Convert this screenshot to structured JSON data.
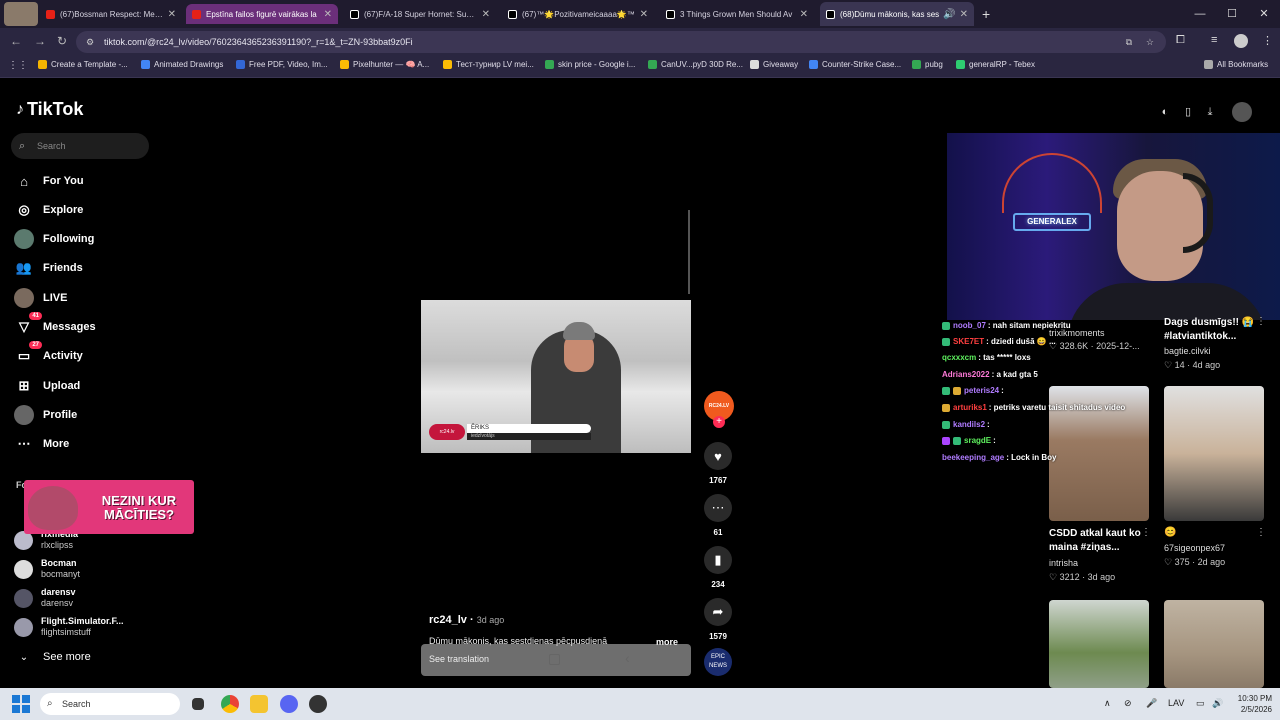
{
  "browser": {
    "tabs": [
      {
        "label": "(67)Bossman Respect: Memorable",
        "favicon_color": "#e62117"
      },
      {
        "label": "Epstīna failos figurē vairākas la",
        "favicon_color": "#e62117"
      },
      {
        "label": "(67)F/A-18 Super Hornet: Super",
        "favicon_color": "#000000"
      },
      {
        "label": "(67)™🌟Pozitivameicaaaa🌟™",
        "favicon_color": "#000000"
      },
      {
        "label": "3 Things Grown Men Should Av",
        "favicon_color": "#000000"
      },
      {
        "label": "(68)Dūmu mākonis, kas ses",
        "favicon_color": "#000000"
      }
    ],
    "new_tab": "+",
    "window_controls": {
      "minimize": "—",
      "maximize": "☐",
      "close": "✕"
    },
    "url": "tiktok.com/@rc24_lv/video/7602364365236391190?_r=1&_t=ZN-93bbat9z0Fi",
    "bookmarks": [
      {
        "label": "Create a Template -...",
        "color": "#f4b400"
      },
      {
        "label": "Animated Drawings",
        "color": "#4285f4"
      },
      {
        "label": "Free PDF, Video, Im...",
        "color": "#3367d6"
      },
      {
        "label": "Pixelhunter — 🧠 A...",
        "color": "#fbbc05"
      },
      {
        "label": "Тест-турнир LV mei...",
        "color": "#fbbc05"
      },
      {
        "label": "skin price - Google i...",
        "color": "#34a853"
      },
      {
        "label": "CanUV...pyD 30D Re...",
        "color": "#34a853"
      },
      {
        "label": "Giveaway",
        "color": "#dddddd"
      },
      {
        "label": "Counter-Strike Case...",
        "color": "#4285f4"
      },
      {
        "label": "pubg",
        "color": "#34a853"
      },
      {
        "label": "generalRP - Tebex",
        "color": "#2ecc71"
      }
    ],
    "all_bookmarks": "All Bookmarks"
  },
  "tiktok": {
    "logo": "TikTok",
    "search_placeholder": "Search",
    "nav": [
      {
        "label": "For You",
        "icon": "home-icon"
      },
      {
        "label": "Explore",
        "icon": "compass-icon"
      },
      {
        "label": "Following",
        "icon": "following-avatar"
      },
      {
        "label": "Friends",
        "icon": "friends-icon"
      },
      {
        "label": "LIVE",
        "icon": "live-avatar"
      },
      {
        "label": "Messages",
        "icon": "messages-icon",
        "badge": "41"
      },
      {
        "label": "Activity",
        "icon": "activity-icon",
        "badge": "27"
      },
      {
        "label": "Upload",
        "icon": "upload-icon"
      },
      {
        "label": "Profile",
        "icon": "profile-avatar"
      },
      {
        "label": "More",
        "icon": "more-icon"
      }
    ],
    "following_header": "Fo",
    "following_accounts": [
      {
        "name": "rlxmedia",
        "handle": "rlxclipss"
      },
      {
        "name": "Bocman",
        "handle": "bocmanyt"
      },
      {
        "name": "darensv",
        "handle": "darensv"
      },
      {
        "name": "Flight.Simulator.F...",
        "handle": "flightsimstuff"
      }
    ],
    "see_more": "See more",
    "ad_text": "NEZINI KUR MĀCĪTIES?",
    "video": {
      "lower_third_name": "ĒRIKS",
      "lower_third_sub": "iedzīvotājs",
      "channel_logo": "rc24.lv",
      "author": "rc24_lv",
      "date": "3d ago",
      "caption": "Dūmu mākonis, kas sestdienas pēcpusdienā",
      "more": "more",
      "see_translation": "See translation"
    },
    "actions": {
      "likes": "1767",
      "comments": "61",
      "saves": "234",
      "shares": "1579",
      "creator_avatar_text": "RC24.LV",
      "news_avatar_text": "EPIC NEWS"
    }
  },
  "stream_overlay": {
    "neon_sign": "GENERALEX",
    "chat": [
      {
        "user": "noob_07",
        "msg": ": nah sitam nepiekritu",
        "color": "#b07cff"
      },
      {
        "user": "SKE7ET",
        "msg": ": dziedi dušā 😄 ...",
        "color": "#ff4040"
      },
      {
        "user": "qcxxxcm",
        "msg": ": tas ***** loxs",
        "color": "#5ef05e"
      },
      {
        "user": "Adrians2022",
        "msg": ": a kad gta 5",
        "color": "#ff7ad9"
      },
      {
        "user": "peteris24",
        "msg": ":",
        "color": "#b07cff"
      },
      {
        "user": "arturiks1",
        "msg": ": petriks varetu taisit shitadus video",
        "color": "#ff4040"
      },
      {
        "user": "kandils2",
        "msg": ":",
        "color": "#b07cff"
      },
      {
        "user": "sragdE",
        "msg": ":",
        "color": "#5ef05e"
      },
      {
        "user": "beekeeping_age",
        "msg": ": Lock in Boy",
        "color": "#b07cff"
      }
    ]
  },
  "recommendations": [
    {
      "title": "",
      "author": "trixikmoments",
      "meta": "♡ 328.6K · 2025-12-...",
      "thumb_color": "#555566"
    },
    {
      "title": "Dags dusmīgs!! 😭 #latviantiktok...",
      "author": "bagtie.cilvki",
      "meta": "♡ 14 · 4d ago",
      "thumb_color": "#444444"
    },
    {
      "title": "CSDD atkal kaut ko maina #ziņas...",
      "author": "intrisha",
      "meta": "♡ 3212 · 3d ago",
      "thumb_color": "#9a7a62"
    },
    {
      "title": "😊",
      "author": "67sigeonpex67",
      "meta": "♡ 375 · 2d ago",
      "thumb_color": "#c9b29a"
    },
    {
      "title": "",
      "author": "",
      "meta": "",
      "thumb_color": "#6d8a50"
    },
    {
      "title": "",
      "author": "",
      "meta": "",
      "thumb_color": "#a69580"
    }
  ],
  "taskbar": {
    "search_placeholder": "Search",
    "lang": "LAV",
    "time": "10:30 PM",
    "date": "2/5/2026"
  }
}
